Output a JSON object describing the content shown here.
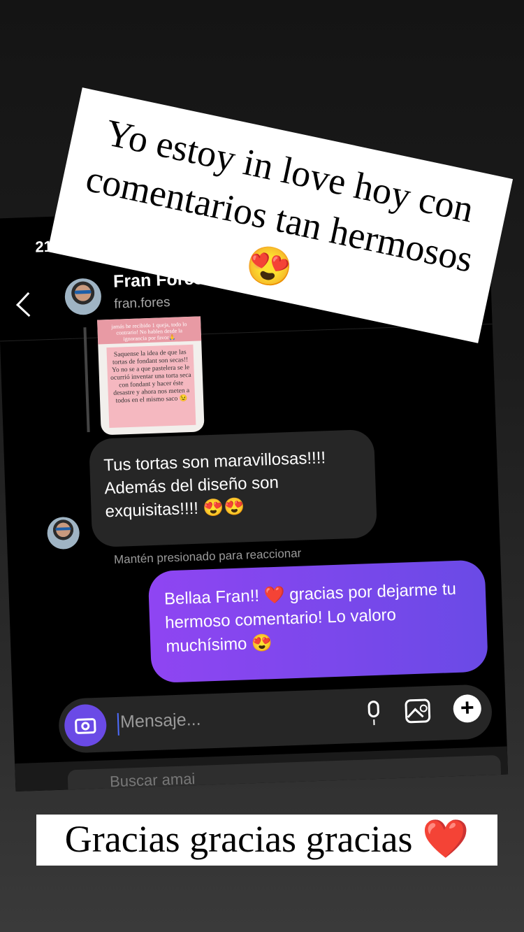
{
  "status": {
    "time": "21:"
  },
  "header": {
    "name": "Fran Fores",
    "username": "fran.fores"
  },
  "shared_post": {
    "top_text": "jamás he recibido 1 queja, todo lo contrario! No hablen desde la ignorancia por favor🙏",
    "main_text": "Saquense la idea de que las tortas de fondant son secas!! Yo no se a que pastelera se le ocurrió inventar una torta seca con fondant y hacer éste desastre y ahora nos meten a todos en el mismo saco 😉"
  },
  "messages": {
    "incoming": "Tus tortas son maravillosas!!!! Además del diseño son exquisitas!!!! 😍😍",
    "hint": "Mantén presionado para reaccionar",
    "outgoing": "Bellaa Fran!! ❤️ gracias por dejarme tu hermoso comentario! Lo valoro muchísimo 😍"
  },
  "composer": {
    "placeholder": "Mensaje..."
  },
  "search": {
    "placeholder": "Buscar amai"
  },
  "captions": {
    "top": "Yo estoy in love hoy con comentarios tan hermosos 😍",
    "bottom": "Gracias gracias gracias ❤️"
  },
  "colors": {
    "outgoing_bubble_start": "#8f45f2",
    "outgoing_bubble_end": "#6a4ae6",
    "incoming_bubble": "#262626"
  }
}
